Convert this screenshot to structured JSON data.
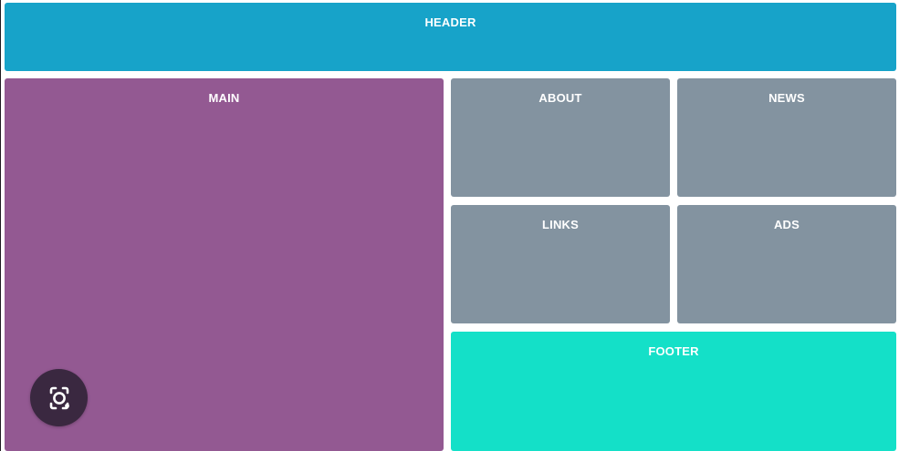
{
  "layout": {
    "header": {
      "label": "HEADER",
      "color": "#17a3c9"
    },
    "main": {
      "label": "MAIN",
      "color": "#935992"
    },
    "about": {
      "label": "ABOUT",
      "color": "#8393a0"
    },
    "news": {
      "label": "NEWS",
      "color": "#8393a0"
    },
    "links": {
      "label": "LINKS",
      "color": "#8393a0"
    },
    "ads": {
      "label": "ADS",
      "color": "#8393a0"
    },
    "footer": {
      "label": "FOOTER",
      "color": "#14e0c8"
    }
  },
  "overlay": {
    "icon": "camera-search-icon"
  }
}
